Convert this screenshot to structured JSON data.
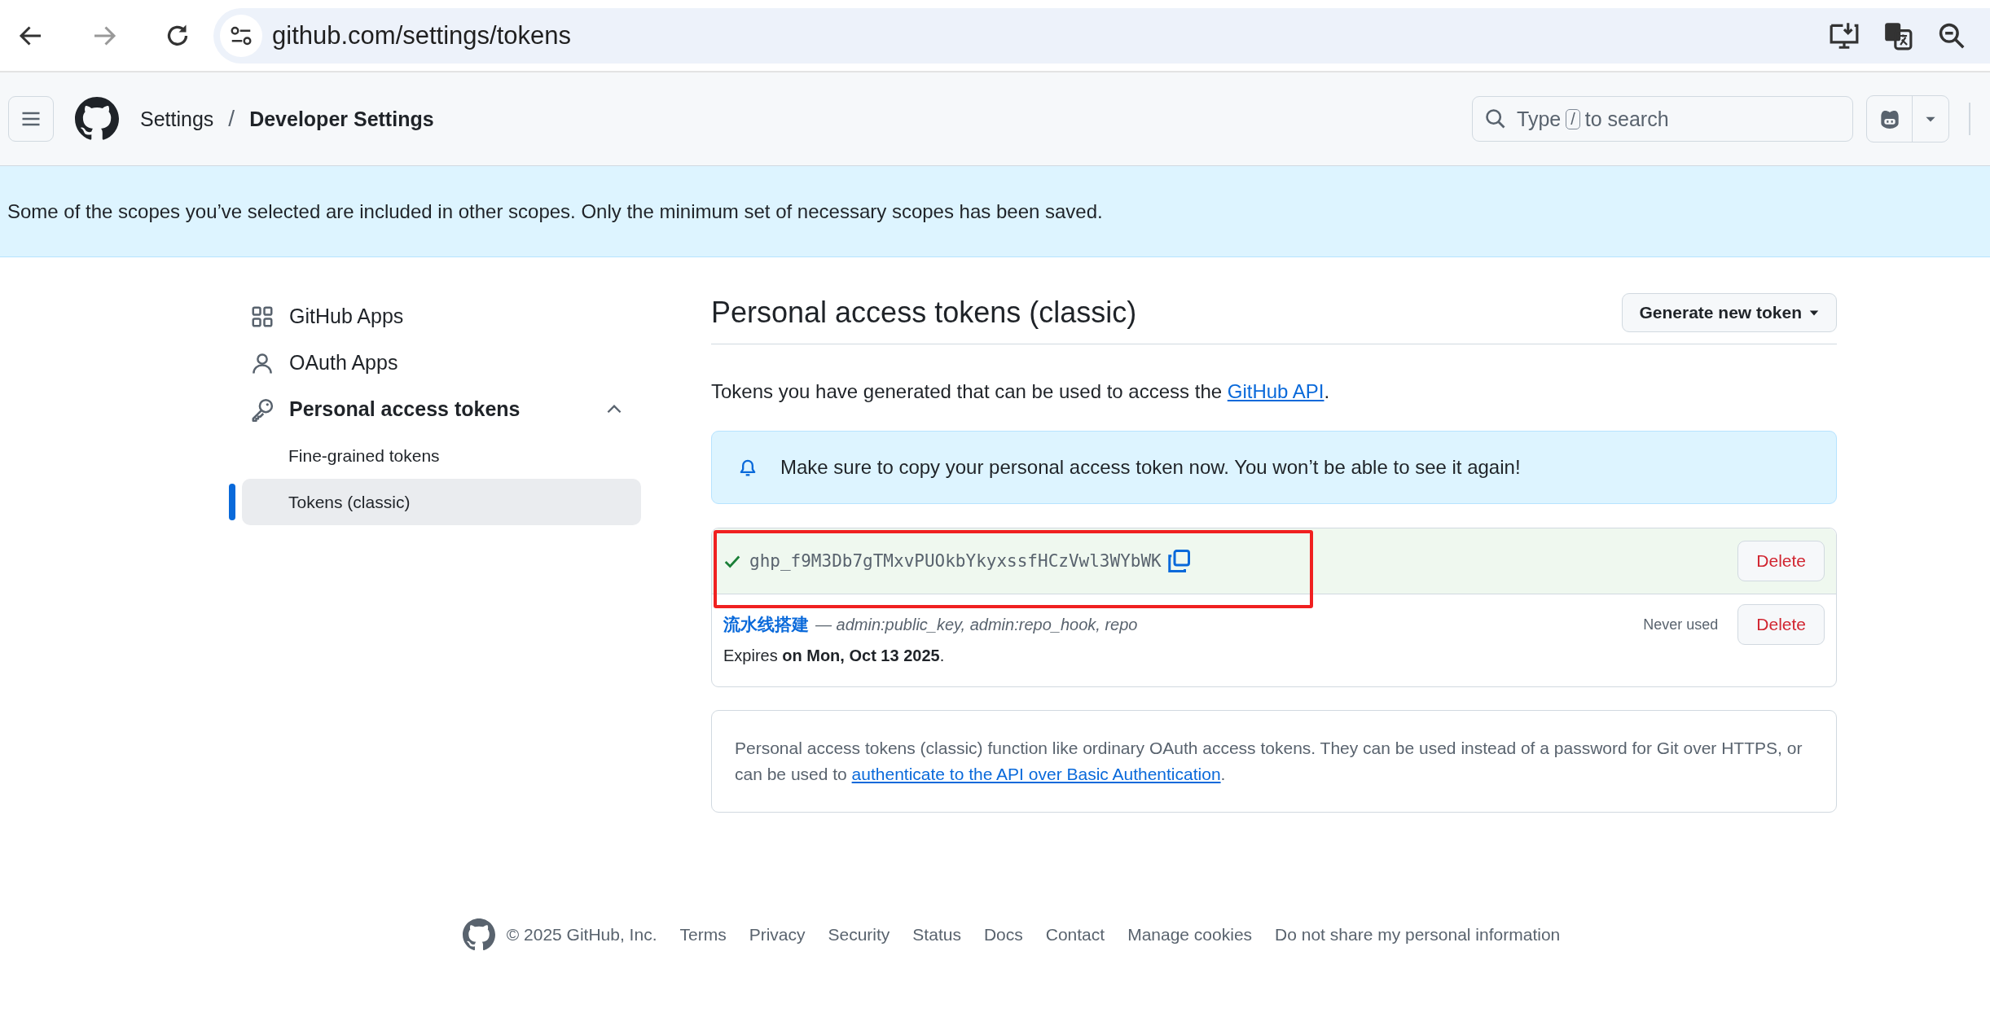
{
  "browser": {
    "url": "github.com/settings/tokens"
  },
  "header": {
    "separator": "/",
    "breadcrumbs": [
      {
        "label": "Settings",
        "current": false
      },
      {
        "label": "Developer Settings",
        "current": true
      }
    ],
    "search": {
      "before": "Type",
      "key": "/",
      "after": "to search"
    }
  },
  "flash": {
    "text": "Some of the scopes you’ve selected are included in other scopes. Only the minimum set of necessary scopes has been saved."
  },
  "sidebar": {
    "items": [
      {
        "label": "GitHub Apps",
        "selected": false
      },
      {
        "label": "OAuth Apps",
        "selected": false
      },
      {
        "label": "Personal access tokens",
        "selected": false,
        "expanded": true,
        "children": [
          {
            "label": "Fine-grained tokens",
            "selected": false
          },
          {
            "label": "Tokens (classic)",
            "selected": true
          }
        ]
      }
    ]
  },
  "main": {
    "title": "Personal access tokens (classic)",
    "generate_button": "Generate new token",
    "intro": "Tokens you have generated that can be used to access the ",
    "intro_link": "GitHub API",
    "intro_end": ".",
    "notice": "Make sure to copy your personal access token now. You won’t be able to see it again!",
    "new_token": {
      "value": "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",
      "highlighted": true,
      "delete": "Delete"
    },
    "token": {
      "name": "流水线搭建",
      "scopes": "— admin:public_key, admin:repo_hook, repo",
      "last_used": "Never used",
      "delete": "Delete",
      "expires": "Expires **on Mon, Oct 13 2025**."
    },
    "info": {
      "text": "Personal access tokens (classic) function like ordinary OAuth access tokens. They can be used instead of a password for Git over HTTPS, or can be used to ",
      "link": "authenticate to the API over Basic Authentication",
      "end": "."
    }
  },
  "footer": {
    "copyright": "© 2025 GitHub, Inc.",
    "links": [
      "Terms",
      "Privacy",
      "Security",
      "Status",
      "Docs",
      "Contact",
      "Manage cookies",
      "Do not share my personal information"
    ]
  }
}
